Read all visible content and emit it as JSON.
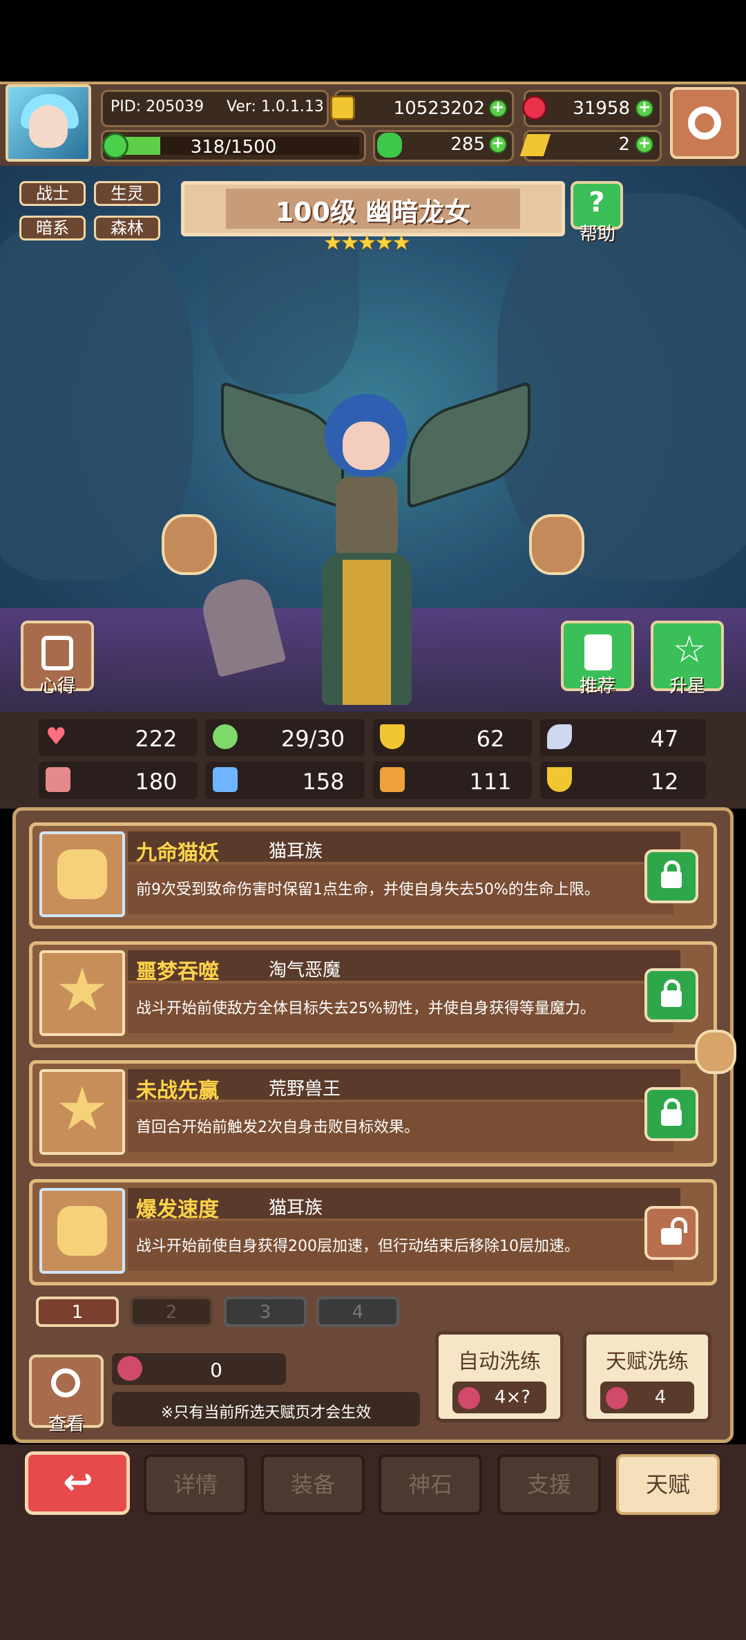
{
  "header": {
    "pid": "PID: 205039",
    "version": "Ver: 1.0.1.13",
    "gold": "10523202",
    "gems": "31958",
    "energy": "318/1500",
    "energy_fraction": 0.21,
    "clover": "285",
    "ticket": "2"
  },
  "hero": {
    "tags": [
      "战士",
      "生灵",
      "暗系",
      "森林"
    ],
    "title": "100级 幽暗龙女",
    "stars": "★★★★★",
    "star_count": 5,
    "help_label": "帮助",
    "notes_label": "心得",
    "recommend_label": "推荐",
    "upstar_label": "升星"
  },
  "stats": {
    "hp": "222",
    "energy": "29/30",
    "defense": "62",
    "speed": "47",
    "attack": "180",
    "magic": "158",
    "resist": "111",
    "crit": "12"
  },
  "talents": [
    {
      "name": "九命猫妖",
      "race": "猫耳族",
      "desc_html": "前9次受到致命伤害时保留1点生命，并使自身失去50%的生命上限。",
      "locked": true,
      "icon": "cat-face-icon"
    },
    {
      "name": "噩梦吞噬",
      "race": "淘气恶魔",
      "desc_html": "战斗开始前使敌方全体目标失去25%韧性，并使自身获得等量魔力。",
      "locked": true,
      "icon": "star-icon"
    },
    {
      "name": "未战先赢",
      "race": "荒野兽王",
      "desc_html": "首回合开始前触发2次自身击败目标效果。",
      "locked": true,
      "icon": "star-icon"
    },
    {
      "name": "爆发速度",
      "race": "猫耳族",
      "desc_html": "战斗开始前使自身获得200层加速，但行动结束后移除10层加速。",
      "locked": false,
      "icon": "cat-face-icon"
    }
  ],
  "pages": [
    "1",
    "2",
    "3",
    "4"
  ],
  "reset": {
    "view_label": "查看",
    "fruit_count": "0",
    "note": "※只有当前所选天赋页才会生效",
    "auto_label": "自动洗练",
    "auto_cost": "4×?",
    "talent_label": "天赋洗练",
    "talent_cost": "4"
  },
  "nav": [
    "详情",
    "装备",
    "神石",
    "支援",
    "天赋"
  ],
  "colors": {
    "accent_green": "#3bbf58",
    "gold": "#ffd44a",
    "panel": "#6b4938"
  }
}
